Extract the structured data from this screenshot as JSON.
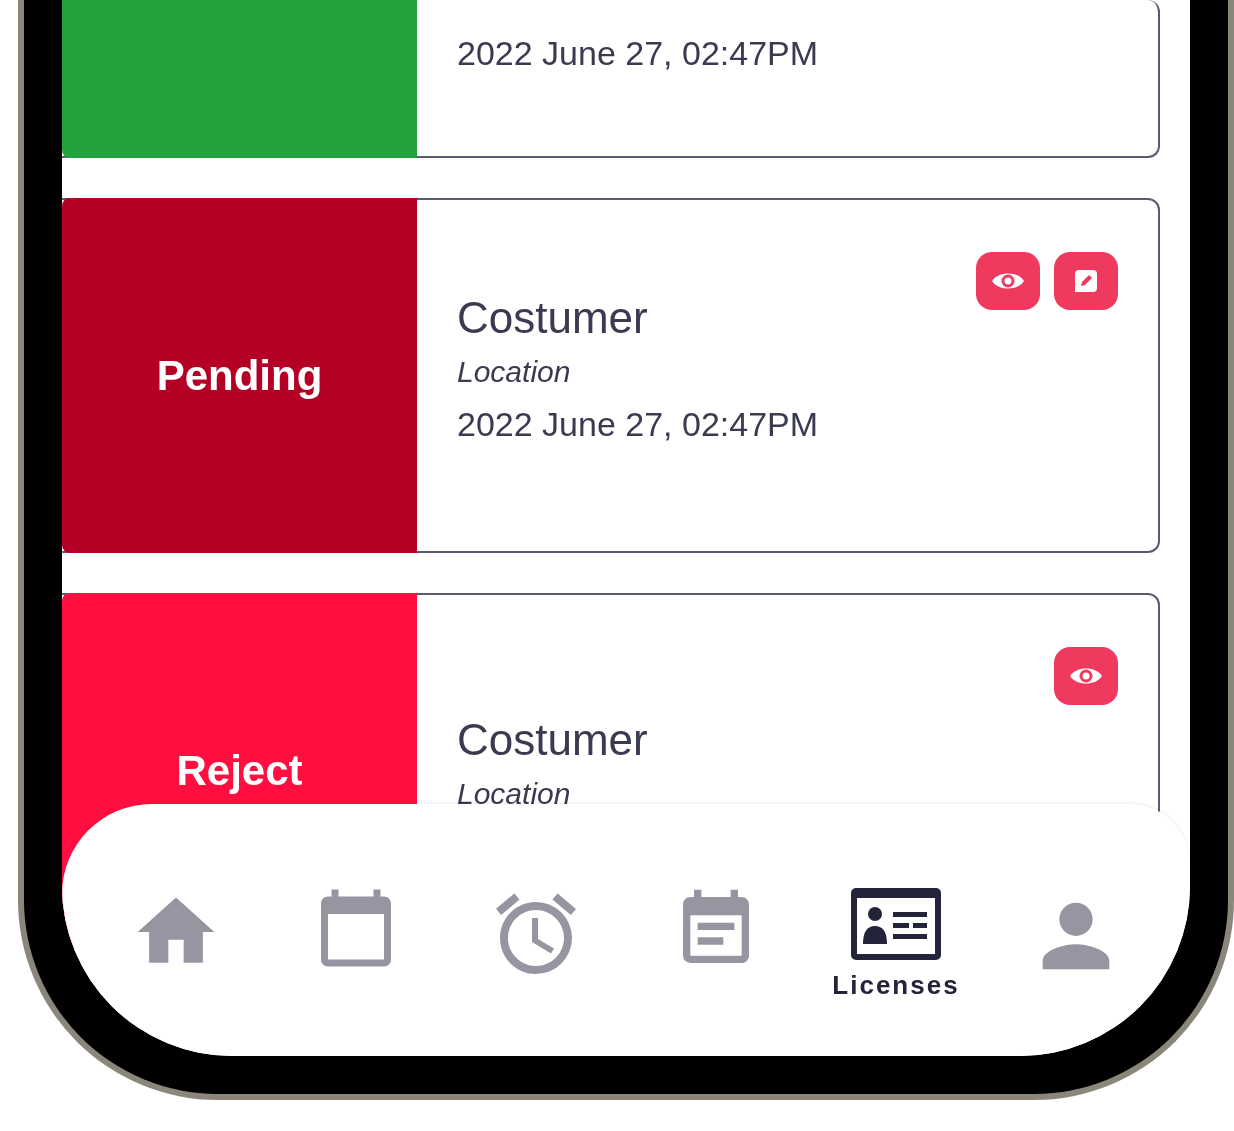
{
  "cards": [
    {
      "color": "#22a33e",
      "date": "2022 June 27, 02:47PM"
    },
    {
      "color": "#b50025",
      "label": "Pending",
      "customer": "Costumer",
      "location": "Location",
      "date": "2022 June 27, 02:47PM",
      "actions": [
        {
          "kind": "view"
        },
        {
          "kind": "edit"
        }
      ]
    },
    {
      "color": "#ff0f40",
      "label": "Reject",
      "customer": "Costumer",
      "location": "Location",
      "actions": [
        {
          "kind": "view"
        }
      ]
    }
  ],
  "nav": [
    {
      "kind": "home",
      "selected": false
    },
    {
      "kind": "calendar",
      "selected": false
    },
    {
      "kind": "alarm",
      "selected": false
    },
    {
      "kind": "notes",
      "selected": false
    },
    {
      "kind": "license",
      "label": "Licenses",
      "selected": true
    },
    {
      "kind": "user",
      "selected": false
    }
  ]
}
